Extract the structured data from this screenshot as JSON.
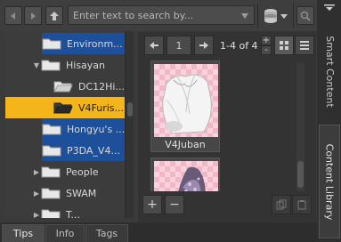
{
  "search": {
    "placeholder": "Enter text to search by..."
  },
  "tree": {
    "items": [
      {
        "label": "Environm...",
        "state": "selected-blue",
        "arrow": ""
      },
      {
        "label": "Hisayan",
        "state": "",
        "arrow": "▼"
      },
      {
        "label": "DC12Hi...",
        "state": "",
        "arrow": ""
      },
      {
        "label": "V4Furis...",
        "state": "selected-gold",
        "arrow": ""
      },
      {
        "label": "Hongyu's ...",
        "state": "selected-blue",
        "arrow": ""
      },
      {
        "label": "P3DA_V4...",
        "state": "selected-blue",
        "arrow": ""
      },
      {
        "label": "People",
        "state": "",
        "arrow": "▶"
      },
      {
        "label": "SWAM",
        "state": "",
        "arrow": "▶"
      },
      {
        "label": "T...",
        "state": "",
        "arrow": "▶"
      }
    ]
  },
  "pager": {
    "page": "1",
    "info": "1-4 of 4"
  },
  "tiles": [
    {
      "label": "V4Juban"
    }
  ],
  "side_tabs": {
    "smart_content": "Smart Content",
    "content_library": "Content Library"
  },
  "bottom_tabs": {
    "tips": "Tips",
    "info": "Info",
    "tags": "Tags"
  },
  "colors": {
    "selected_blue": "#1d4f9a",
    "selected_gold": "#f3b519"
  }
}
